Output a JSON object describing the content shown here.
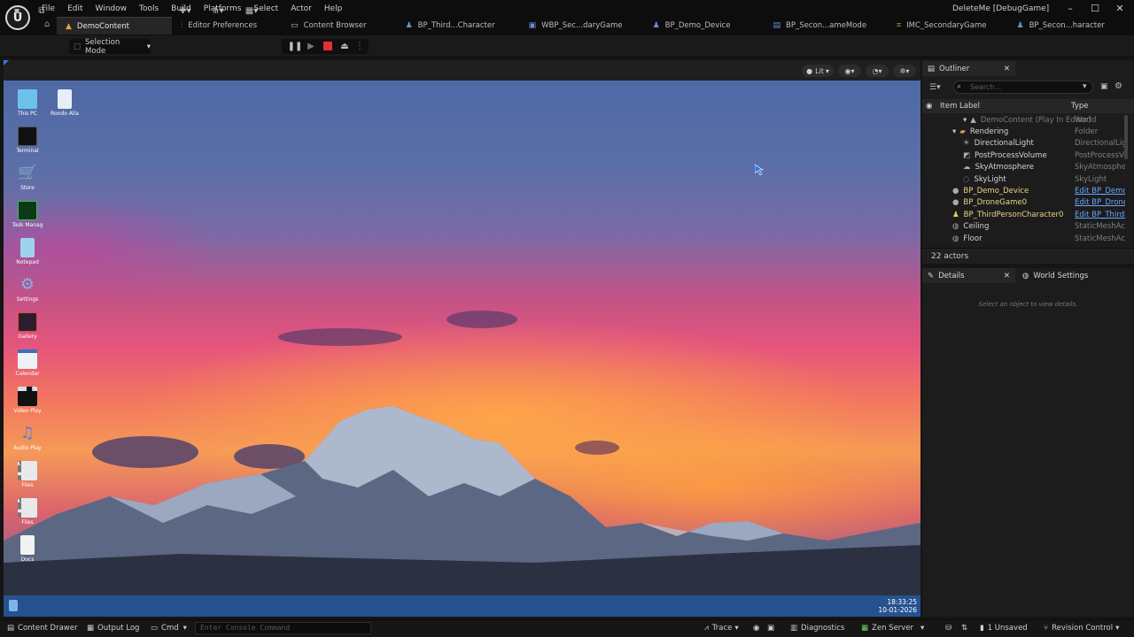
{
  "menu": [
    "File",
    "Edit",
    "Window",
    "Tools",
    "Build",
    "Platforms",
    "Select",
    "Actor",
    "Help"
  ],
  "window_title": "DeleteMe [DebugGame]",
  "tabs": [
    {
      "label": "DemoContent",
      "icon": "level-icon"
    },
    {
      "label": "Editor Preferences",
      "icon": "sliders-icon"
    },
    {
      "label": "Content Browser",
      "icon": "folder-icon"
    },
    {
      "label": "BP_Third...Character",
      "icon": "character-icon"
    },
    {
      "label": "WBP_Sec...daryGame",
      "icon": "widget-icon"
    },
    {
      "label": "BP_Demo_Device",
      "icon": "character-icon"
    },
    {
      "label": "BP_Secon...ameMode",
      "icon": "blueprint-icon"
    },
    {
      "label": "IMC_SecondaryGame",
      "icon": "input-icon"
    },
    {
      "label": "BP_Secon...haracter",
      "icon": "character-icon"
    }
  ],
  "toolbar": {
    "selection_mode": "Selection Mode"
  },
  "viewport": {
    "lit_label": "Lit"
  },
  "desktop": {
    "icons": [
      "This PC",
      "Rondo Alla",
      "Terminal",
      "Store",
      "Task Manag",
      "Notepad",
      "Settings",
      "Gallery",
      "Calendar",
      "Video Play",
      "Audio Play",
      "Files",
      "Files",
      "Docs"
    ],
    "clock_time": "18:33:25",
    "clock_date": "10-01-2026"
  },
  "outliner": {
    "title": "Outliner",
    "search_placeholder": "Search...",
    "col_label": "Item Label",
    "col_type": "Type",
    "rows": [
      {
        "label": "DemoContent (Play In Editor)",
        "type": "World",
        "dim": true,
        "link": false
      },
      {
        "label": "Rendering",
        "type": "Folder",
        "dim": false,
        "link": false
      },
      {
        "label": "DirectionalLight",
        "type": "DirectionalLight",
        "dim": false,
        "link": false
      },
      {
        "label": "PostProcessVolume",
        "type": "PostProcessVolume",
        "dim": false,
        "link": false
      },
      {
        "label": "SkyAtmosphere",
        "type": "SkyAtmosphere",
        "dim": false,
        "link": false
      },
      {
        "label": "SkyLight",
        "type": "SkyLight",
        "dim": false,
        "link": false
      },
      {
        "label": "BP_Demo_Device",
        "type": "Edit BP_Demo",
        "dim": false,
        "link": true
      },
      {
        "label": "BP_DroneGame0",
        "type": "Edit BP_Drone",
        "dim": false,
        "link": true
      },
      {
        "label": "BP_ThirdPersonCharacter0",
        "type": "Edit BP_ThirdP",
        "dim": false,
        "link": true
      },
      {
        "label": "Ceiling",
        "type": "StaticMeshActor",
        "dim": false,
        "link": false
      },
      {
        "label": "Floor",
        "type": "StaticMeshActor",
        "dim": false,
        "link": false
      }
    ],
    "count": "22 actors"
  },
  "details": {
    "title": "Details",
    "world_settings": "World Settings",
    "empty": "Select an object to view details."
  },
  "statusbar": {
    "content_drawer": "Content Drawer",
    "output_log": "Output Log",
    "cmd": "Cmd",
    "console_placeholder": "Enter Console Command",
    "trace": "Trace",
    "diagnostics": "Diagnostics",
    "zen_server": "Zen Server",
    "unsaved": "1 Unsaved",
    "revision_control": "Revision Control"
  }
}
